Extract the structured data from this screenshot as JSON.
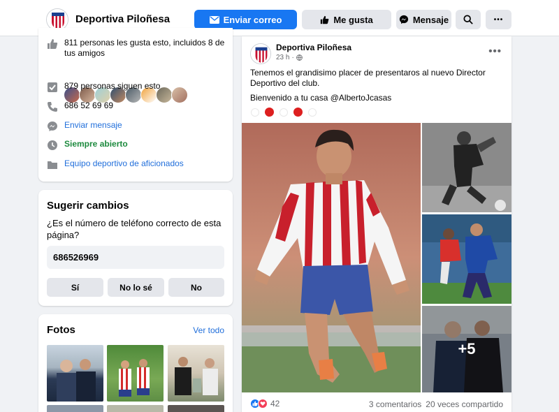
{
  "header": {
    "page_name": "Deportiva Piloñesa",
    "send_email": "Enviar correo",
    "like": "Me gusta",
    "message": "Mensaje",
    "more": "•••"
  },
  "info": {
    "likes_text": "811 personas les gusta esto, incluidos 8 de tus amigos",
    "followers_text": "879 personas siguen esto",
    "phone": "686 52 69 69",
    "send_message": "Enviar mensaje",
    "hours": "Siempre abierto",
    "category": "Equipo deportivo de aficionados"
  },
  "suggest": {
    "title": "Sugerir cambios",
    "question": "¿Es el número de teléfono correcto de esta página?",
    "phone_value": "686526969",
    "options": [
      "Sí",
      "No lo sé",
      "No"
    ]
  },
  "photos": {
    "title": "Fotos",
    "see_all": "Ver todo"
  },
  "post": {
    "author": "Deportiva Piloñesa",
    "time": "23 h",
    "menu": "•••",
    "text_line1": "Tenemos el grandisimo placer de presentaros al nuevo Director Deportivo del club.",
    "text_line2": "Bienvenido a tu casa @AlbertoJcasas",
    "more_photos": "+5",
    "reaction_count": "42",
    "comments": "3 comentarios",
    "shares": "20 veces compartido"
  },
  "colors": {
    "accent": "#1877f2",
    "link": "#216fdb",
    "open_status": "#1d8a3e"
  }
}
